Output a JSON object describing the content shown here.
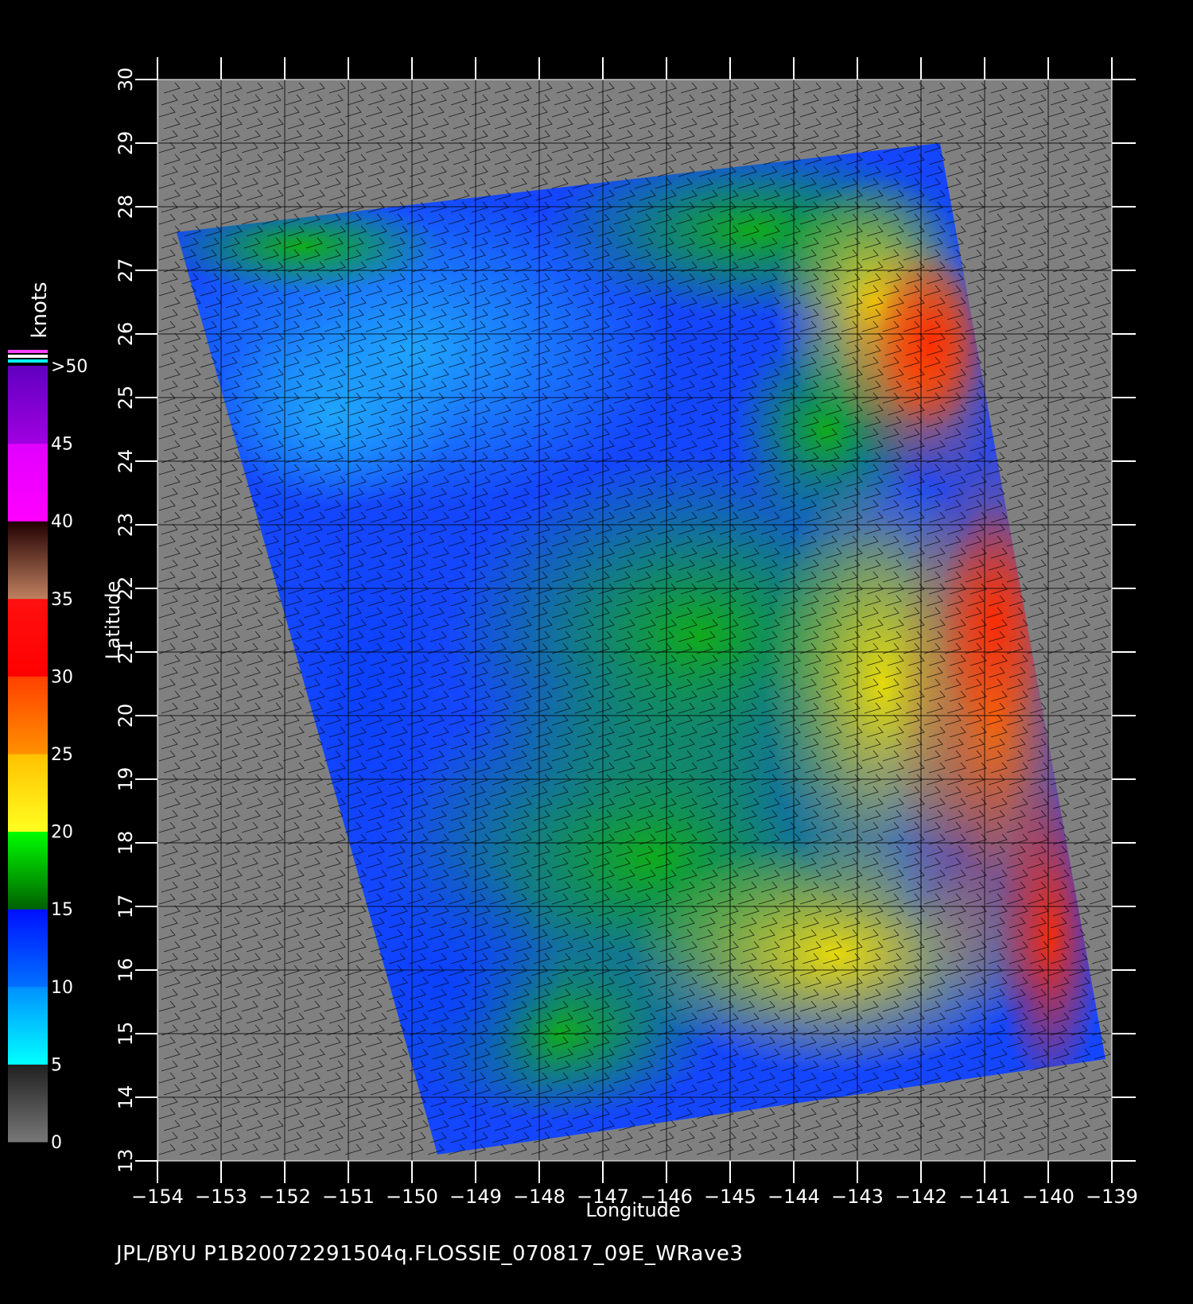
{
  "chart_data": {
    "type": "heatmap",
    "title": "",
    "xlabel": "Longitude",
    "ylabel": "Latitude",
    "xlim": [
      -154,
      -139
    ],
    "ylim": [
      13,
      30
    ],
    "x_ticks": [
      -154,
      -153,
      -152,
      -151,
      -150,
      -149,
      -148,
      -147,
      -146,
      -145,
      -144,
      -143,
      -142,
      -141,
      -140,
      -139
    ],
    "x_tick_labels": [
      "−154",
      "−153",
      "−152",
      "−151",
      "−150",
      "−149",
      "−148",
      "−147",
      "−146",
      "−145",
      "−144",
      "−143",
      "−142",
      "−141",
      "−140",
      "−139"
    ],
    "y_ticks": [
      13,
      14,
      15,
      16,
      17,
      18,
      19,
      20,
      21,
      22,
      23,
      24,
      25,
      26,
      27,
      28,
      29,
      30
    ],
    "y_tick_labels": [
      "13",
      "14",
      "15",
      "16",
      "17",
      "18",
      "19",
      "20",
      "21",
      "22",
      "23",
      "24",
      "25",
      "26",
      "27",
      "28",
      "29",
      "30"
    ],
    "grid": true,
    "swath_corners_lonlat": {
      "top_left": [
        -153.7,
        27.6
      ],
      "top_right": [
        -141.7,
        29.0
      ],
      "bottom_right": [
        -139.1,
        14.6
      ],
      "bottom_left": [
        -149.6,
        13.1
      ]
    },
    "speed_regions_knots": [
      {
        "region": "north-west swath",
        "lon": [
          -153,
          -147
        ],
        "lat": [
          23,
          28
        ],
        "speed": "5-15"
      },
      {
        "region": "north-central swath",
        "lon": [
          -147,
          -143
        ],
        "lat": [
          23.5,
          28
        ],
        "speed": "10-15"
      },
      {
        "region": "north-east swath",
        "lon": [
          -143,
          -141
        ],
        "lat": [
          22.5,
          27
        ],
        "speed": "25-35"
      },
      {
        "region": "central swath",
        "lon": [
          -148,
          -144
        ],
        "lat": [
          17,
          23
        ],
        "speed": "15-20"
      },
      {
        "region": "east-central swath",
        "lon": [
          -143,
          -141
        ],
        "lat": [
          17,
          22
        ],
        "speed": "20-30"
      },
      {
        "region": "south-west swath",
        "lon": [
          -150,
          -147
        ],
        "lat": [
          13,
          19
        ],
        "speed": "10-15"
      },
      {
        "region": "south-east swath",
        "lon": [
          -143,
          -139.5
        ],
        "lat": [
          14.5,
          18
        ],
        "speed": "20-30"
      }
    ],
    "wind_direction": "north-easterly trade winds (wind barbs over the whole domain)"
  },
  "colorbar": {
    "unit_label": "knots",
    "ticks": [
      "0",
      "5",
      "10",
      "15",
      "20",
      "25",
      "30",
      "35",
      "40",
      "45",
      ">50"
    ],
    "segments": [
      {
        "from": 0,
        "to": 5,
        "colors": [
          "#787878",
          "#202020"
        ]
      },
      {
        "from": 5,
        "to": 10,
        "colors": [
          "#00ffff",
          "#0090ff"
        ]
      },
      {
        "from": 10,
        "to": 15,
        "colors": [
          "#0070ff",
          "#0010ff"
        ]
      },
      {
        "from": 15,
        "to": 20,
        "colors": [
          "#006000",
          "#00ff00"
        ]
      },
      {
        "from": 20,
        "to": 25,
        "colors": [
          "#ffff20",
          "#ffc000"
        ]
      },
      {
        "from": 25,
        "to": 30,
        "colors": [
          "#ff9000",
          "#ff4000"
        ]
      },
      {
        "from": 30,
        "to": 35,
        "colors": [
          "#ff0000",
          "#ff1010"
        ]
      },
      {
        "from": 35,
        "to": 40,
        "colors": [
          "#c08060",
          "#200000"
        ]
      },
      {
        "from": 40,
        "to": 45,
        "colors": [
          "#ff00ff",
          "#e000ff"
        ]
      },
      {
        "from": 45,
        "to": 50,
        "colors": [
          "#a000e0",
          "#6000c0"
        ]
      }
    ],
    "over_colors": [
      "#ff40ff",
      "#ffffff",
      "#00ffff"
    ]
  },
  "colors": {
    "background": "#000000",
    "land_nodata": "#808080",
    "axes": "#ffffff",
    "barbs": "#000000"
  },
  "footer": "JPL/BYU  P1B20072291504q.FLOSSIE_070817_09E_WRave3"
}
